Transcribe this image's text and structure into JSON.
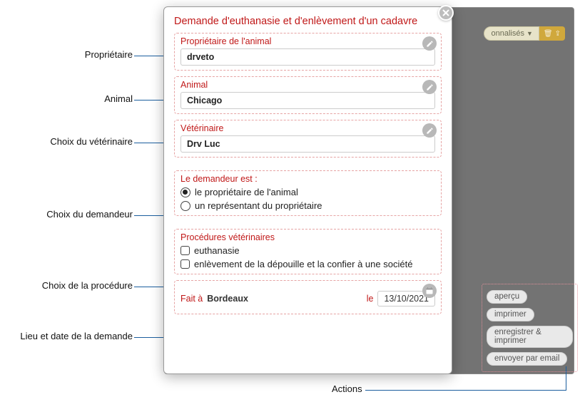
{
  "annotations": {
    "owner": "Propriétaire",
    "animal": "Animal",
    "vet": "Choix du vétérinaire",
    "requester": "Choix du demandeur",
    "procedure": "Choix de la procédure",
    "place_date": "Lieu et date de la demande",
    "actions": "Actions"
  },
  "bg": {
    "dropdown_text": "onnalisés",
    "icon1": "trash-icon",
    "icon2": "upload-icon"
  },
  "modal": {
    "title": "Demande d'euthanasie et d'enlèvement d'un cadavre",
    "owner": {
      "label": "Propriétaire de l'animal",
      "value": "drveto"
    },
    "animal": {
      "label": "Animal",
      "value": "Chicago"
    },
    "vet": {
      "label": "Vétérinaire",
      "value": "Drv Luc"
    },
    "requester": {
      "label": "Le demandeur est :",
      "opt1": "le propriétaire de l'animal",
      "opt2": "un représentant du propriétaire"
    },
    "procedures": {
      "label": "Procédures vétérinaires",
      "opt1": "euthanasie",
      "opt2": "enlèvement de la dépouille et la confier à une société"
    },
    "bottom": {
      "fait_a": "Fait à",
      "place": "Bordeaux",
      "le": "le",
      "date": "13/10/2021"
    }
  },
  "actions": {
    "preview": "aperçu",
    "print": "imprimer",
    "save_print": "enregistrer & imprimer",
    "email": "envoyer par email"
  }
}
